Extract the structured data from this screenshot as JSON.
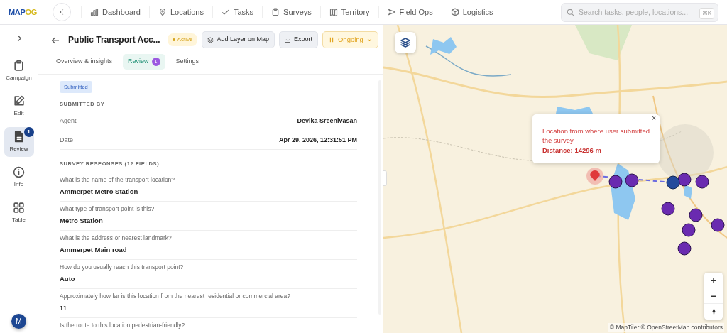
{
  "brand": {
    "main": "MAP",
    "accent": "OG"
  },
  "nav": [
    {
      "label": "Dashboard",
      "kind": "chart"
    },
    {
      "label": "Locations",
      "kind": "pin"
    },
    {
      "label": "Tasks",
      "kind": "check"
    },
    {
      "label": "Surveys",
      "kind": "clipboard"
    },
    {
      "label": "Territory",
      "kind": "map"
    },
    {
      "label": "Field Ops",
      "kind": "send"
    },
    {
      "label": "Logistics",
      "kind": "box"
    }
  ],
  "search": {
    "placeholder": "Search tasks, people, locations...",
    "shortcut": "⌘K"
  },
  "rail": [
    {
      "label": "Campaign",
      "kind": "clipboard",
      "selected": false
    },
    {
      "label": "Edit",
      "kind": "edit",
      "selected": false
    },
    {
      "label": "Review",
      "kind": "doc",
      "selected": true,
      "badge": "1"
    },
    {
      "label": "Info",
      "kind": "info",
      "selected": false
    },
    {
      "label": "Table",
      "kind": "grid",
      "selected": false
    }
  ],
  "avatar": "M",
  "header": {
    "title": "Public Transport Acc...",
    "status": "Active",
    "actions": [
      {
        "label": "Add Layer on Map",
        "kind": "layers"
      },
      {
        "label": "Export",
        "kind": "download"
      }
    ],
    "stage": "Ongoing"
  },
  "tabs": [
    {
      "label": "Overview & insights",
      "selected": false
    },
    {
      "label": "Review",
      "selected": true,
      "badge": "1"
    },
    {
      "label": "Settings",
      "selected": false
    }
  ],
  "submission": {
    "status": "Submitted",
    "section": "SUBMITTED BY",
    "details": [
      {
        "label": "Agent",
        "value": "Devika Sreenivasan"
      },
      {
        "label": "Date",
        "value": "Apr 29, 2026, 12:31:51 PM"
      }
    ]
  },
  "responses": {
    "title": "SURVEY RESPONSES (12 FIELDS)",
    "items": [
      {
        "question": "What is the name of the transport location?",
        "answer": "Ammerpet Metro Station"
      },
      {
        "question": "What type of transport point is this?",
        "answer": "Metro Station"
      },
      {
        "question": "What is the address or nearest landmark?",
        "answer": "Ammerpet Main road"
      },
      {
        "question": "How do you usually reach this transport point?",
        "answer": "Auto"
      },
      {
        "question": "Approximately how far is this location from the nearest residential or commercial area?",
        "answer": "11"
      },
      {
        "question": "Is the route to this location pedestrian-friendly?"
      }
    ]
  },
  "map": {
    "popup": {
      "message": "Location from where user submitted the survey",
      "distance": "Distance: 14296 m",
      "close": "×"
    },
    "zoom": [
      "+",
      "−"
    ],
    "attribution": "© MapTiler © OpenStreetMap contributors"
  }
}
